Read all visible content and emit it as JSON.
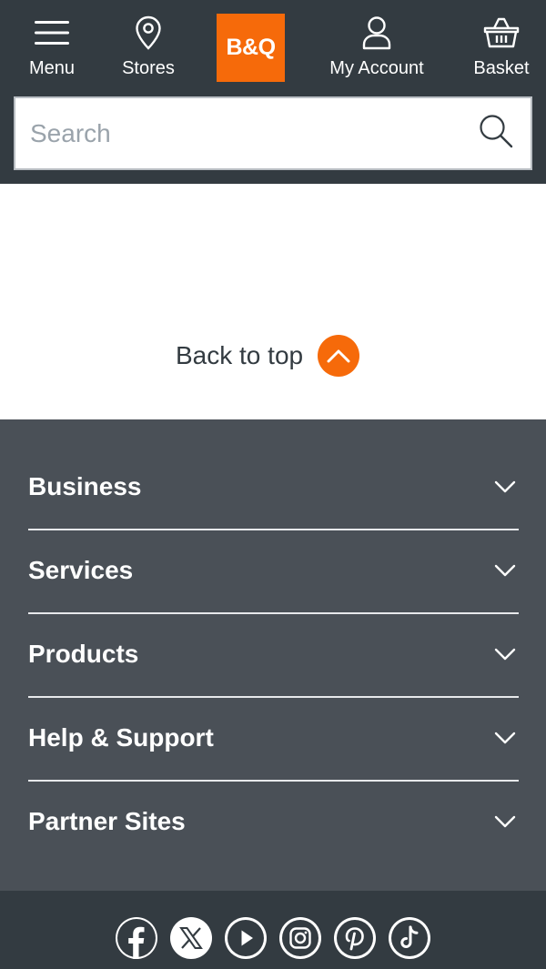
{
  "header": {
    "menu_label": "Menu",
    "stores_label": "Stores",
    "logo_text": "B&Q",
    "account_label": "My Account",
    "basket_label": "Basket",
    "search_placeholder": "Search"
  },
  "back_to_top": {
    "label": "Back to top"
  },
  "footer": {
    "sections": [
      {
        "label": "Business"
      },
      {
        "label": "Services"
      },
      {
        "label": "Products"
      },
      {
        "label": "Help & Support"
      },
      {
        "label": "Partner Sites"
      }
    ]
  },
  "social": {
    "icons": [
      "facebook-icon",
      "x-icon",
      "youtube-icon",
      "instagram-icon",
      "pinterest-icon",
      "tiktok-icon"
    ]
  },
  "colors": {
    "header_bg": "#333b41",
    "footer_bg": "#4a5057",
    "brand_orange": "#f66a0a"
  }
}
